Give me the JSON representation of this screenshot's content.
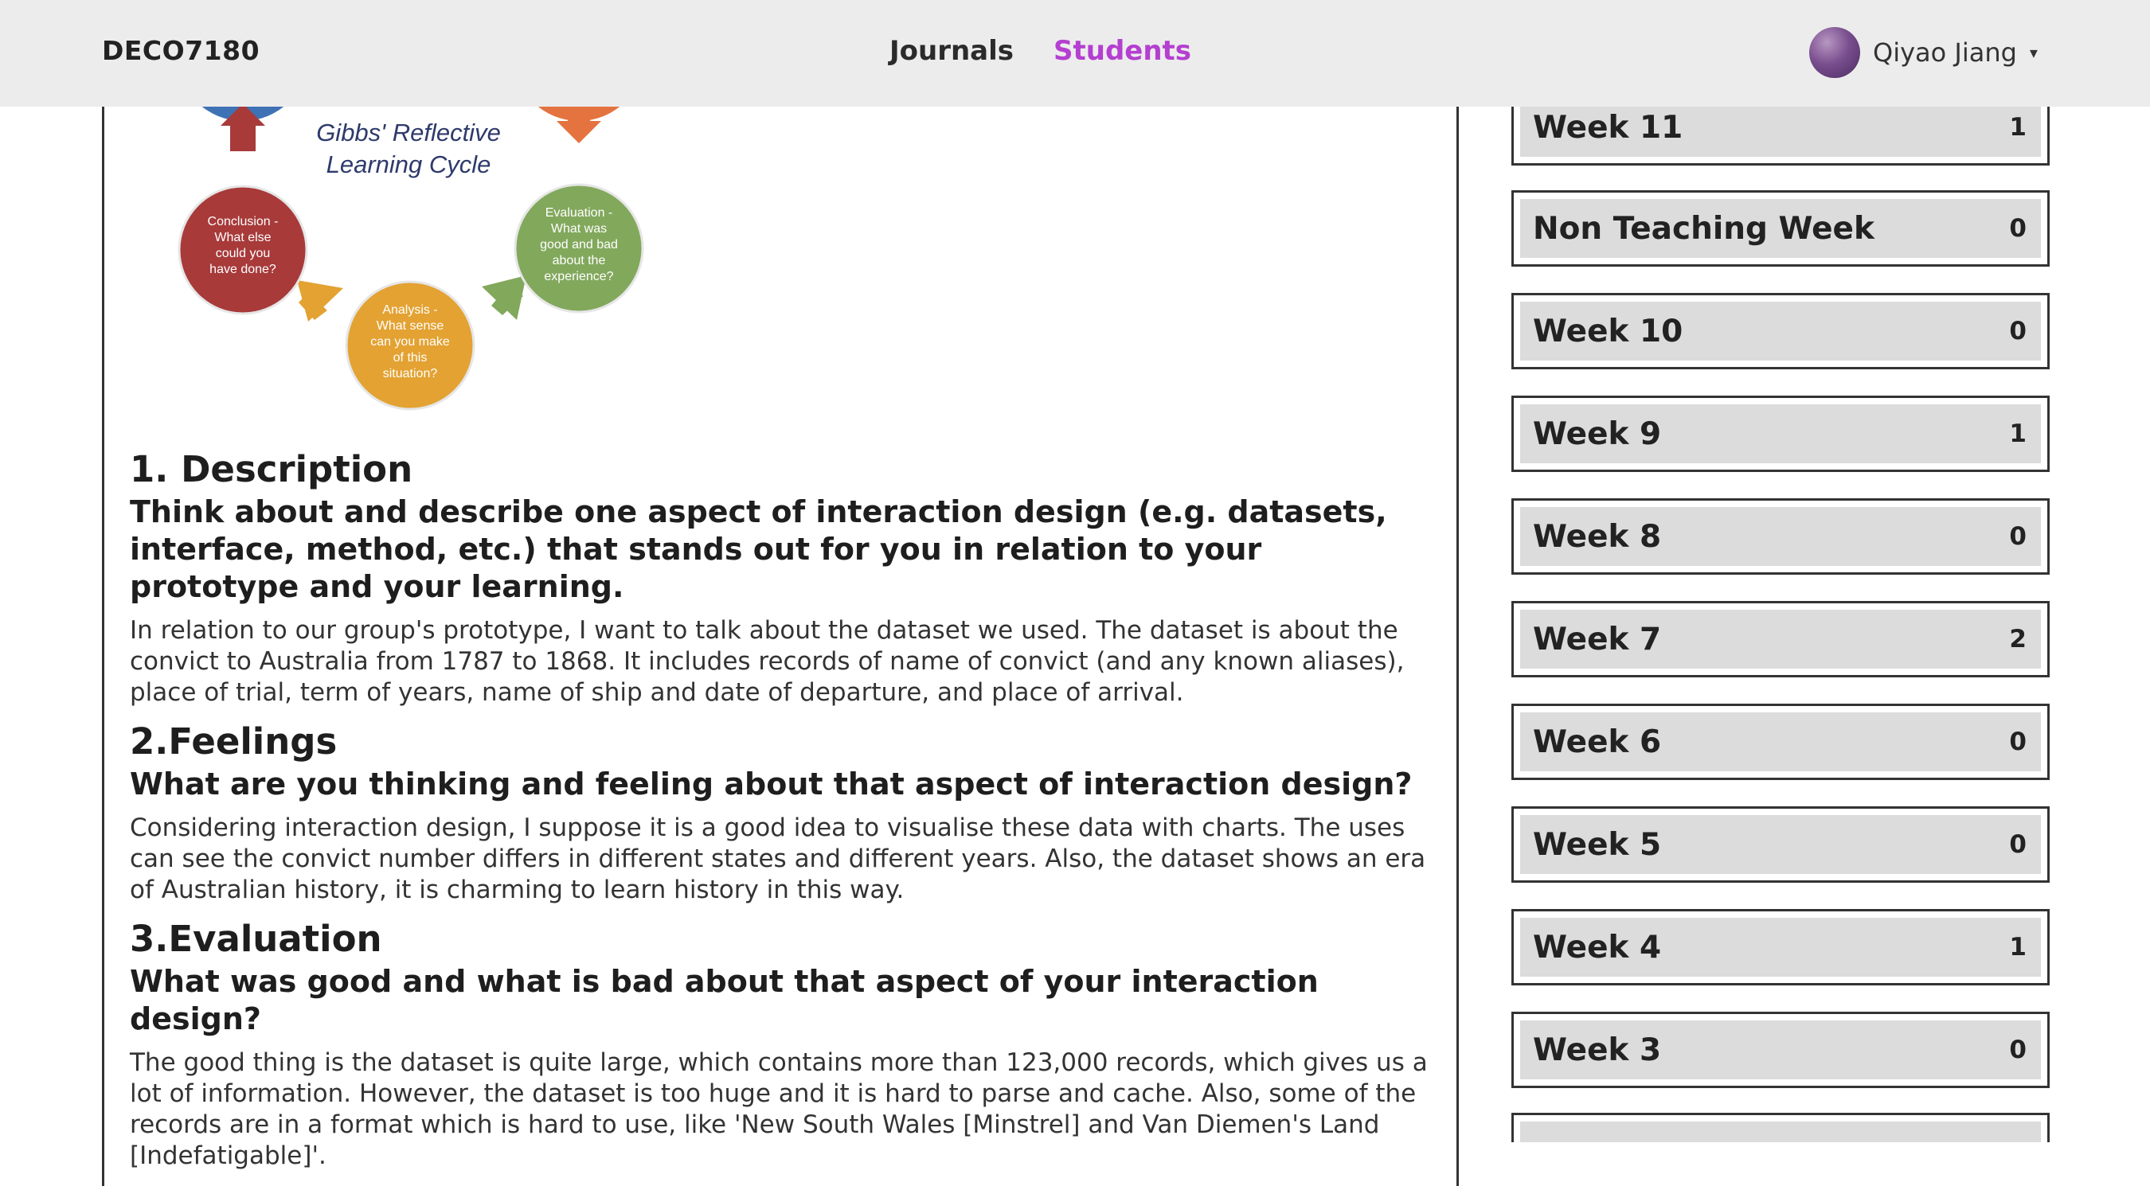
{
  "nav": {
    "brand": "DECO7180",
    "links": [
      {
        "label": "Journals"
      },
      {
        "label": "Students"
      }
    ],
    "user_name": "Qiyao Jiang",
    "caret": "▾",
    "active_color": "#b43fd0"
  },
  "diagram": {
    "title_line1": "Gibbs' Reflective",
    "title_line2": "Learning Cycle",
    "conclusion": [
      "Conclusion -",
      "What else",
      "could you",
      "have done?"
    ],
    "evaluation": [
      "Evaluation -",
      "What was",
      "good and bad",
      "about the",
      "experience?"
    ],
    "analysis": [
      "Analysis -",
      "What sense",
      "can you make",
      "of this",
      "situation?"
    ],
    "colors": {
      "conclusion": "#a83a3a",
      "evaluation": "#82a85c",
      "analysis": "#e3a232",
      "blue": "#3f72b5",
      "orange": "#e4733f"
    }
  },
  "journal": {
    "sections": [
      {
        "title": "1. Description",
        "question": "Think about and describe one aspect of interaction design (e.g. datasets, interface, method, etc.) that stands out for you in relation to your prototype and your learning.",
        "body": "In relation to our group's prototype, I want to talk about the dataset we used. The dataset is about the convict to Australia from 1787 to 1868. It includes records of name of convict (and any known aliases), place of trial, term of years, name of ship and date of departure, and place of arrival."
      },
      {
        "title": "2.Feelings",
        "question": "What are you thinking and feeling about that aspect of interaction design?",
        "body": "Considering interaction design, I suppose it is a good idea to visualise these data with charts. The uses can see the convict number differs in different states and different years. Also, the dataset shows an era of Australian history, it is charming to learn history in this way."
      },
      {
        "title": "3.Evaluation",
        "question": "What was good and what is bad about that aspect of your interaction design?",
        "body": "The good thing is the dataset is quite large, which contains more than 123,000 records, which gives us a lot of information. However, the dataset is too huge and it is hard to parse and cache. Also, some of the records are in a format which is hard to use, like 'New South Wales [Minstrel] and Van Diemen's Land [Indefatigable]'."
      }
    ]
  },
  "weeks": [
    {
      "label": "Week 11",
      "count": "1"
    },
    {
      "label": "Non Teaching Week",
      "count": "0"
    },
    {
      "label": "Week 10",
      "count": "0"
    },
    {
      "label": "Week 9",
      "count": "1"
    },
    {
      "label": "Week 8",
      "count": "0"
    },
    {
      "label": "Week 7",
      "count": "2"
    },
    {
      "label": "Week 6",
      "count": "0"
    },
    {
      "label": "Week 5",
      "count": "0"
    },
    {
      "label": "Week 4",
      "count": "1"
    },
    {
      "label": "Week 3",
      "count": "0"
    },
    {
      "label": "",
      "count": ""
    }
  ]
}
